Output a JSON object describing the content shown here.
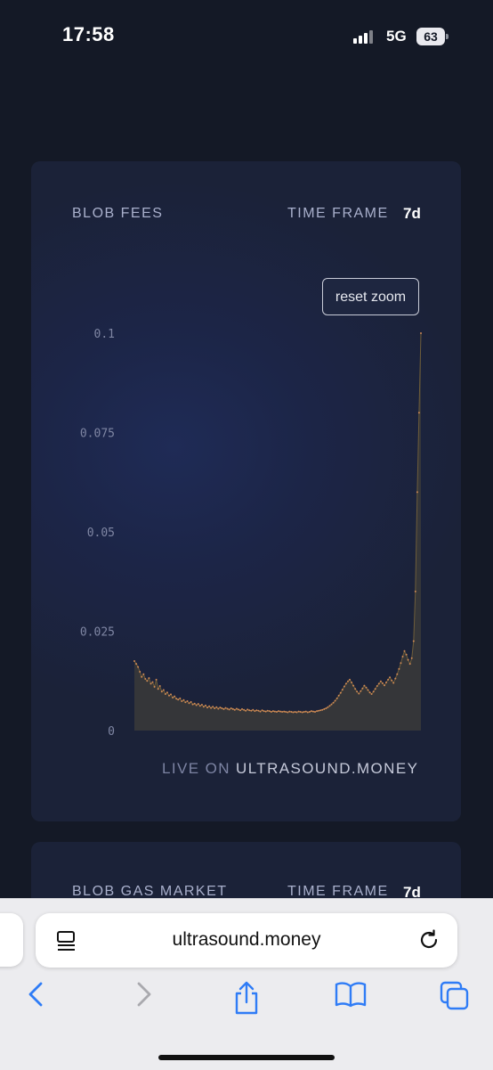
{
  "status_bar": {
    "time": "17:58",
    "network": "5G",
    "battery": "63"
  },
  "card": {
    "title": "BLOB FEES",
    "time_frame_label": "TIME FRAME",
    "time_frame_value": "7d",
    "reset_zoom_label": "reset zoom",
    "footer_prefix": "LIVE ON",
    "footer_site": "ULTRASOUND.MONEY"
  },
  "chart_data": {
    "type": "area",
    "title": "BLOB FEES",
    "xlabel": "",
    "ylabel": "",
    "ylim": [
      0,
      0.105
    ],
    "y_ticks": [
      0,
      0.025,
      0.05,
      0.075,
      0.1
    ],
    "y_tick_labels": [
      "0",
      "0.025",
      "0.05",
      "0.075",
      "0.1"
    ],
    "grid": false,
    "series": [
      {
        "values": [
          0.0175,
          0.0168,
          0.016,
          0.0148,
          0.0135,
          0.0142,
          0.013,
          0.0125,
          0.0132,
          0.0118,
          0.0122,
          0.011,
          0.0128,
          0.0105,
          0.0112,
          0.0098,
          0.0102,
          0.0092,
          0.0096,
          0.0088,
          0.0091,
          0.0083,
          0.0086,
          0.008,
          0.0078,
          0.0081,
          0.0074,
          0.0077,
          0.0071,
          0.0074,
          0.0069,
          0.0072,
          0.0066,
          0.0068,
          0.0064,
          0.0067,
          0.0062,
          0.0065,
          0.006,
          0.0063,
          0.0058,
          0.0061,
          0.0057,
          0.006,
          0.0056,
          0.0059,
          0.0055,
          0.0058,
          0.0056,
          0.0054,
          0.0057,
          0.0055,
          0.0053,
          0.0056,
          0.0054,
          0.0052,
          0.0055,
          0.0053,
          0.0051,
          0.0054,
          0.0052,
          0.005,
          0.0053,
          0.0051,
          0.005,
          0.0052,
          0.0049,
          0.0051,
          0.005,
          0.0048,
          0.0051,
          0.0049,
          0.0048,
          0.005,
          0.0049,
          0.0047,
          0.0049,
          0.0048,
          0.0047,
          0.0049,
          0.0048,
          0.0047,
          0.0048,
          0.0047,
          0.0046,
          0.0048,
          0.0047,
          0.0046,
          0.0047,
          0.0046,
          0.0048,
          0.0047,
          0.0046,
          0.0047,
          0.0048,
          0.0046,
          0.0047,
          0.0049,
          0.0048,
          0.0047,
          0.0049,
          0.005,
          0.0051,
          0.0052,
          0.0054,
          0.0056,
          0.0059,
          0.0062,
          0.0066,
          0.007,
          0.0075,
          0.0081,
          0.0088,
          0.0095,
          0.0103,
          0.0111,
          0.0118,
          0.0124,
          0.0128,
          0.0121,
          0.0113,
          0.0105,
          0.0098,
          0.0093,
          0.0099,
          0.0106,
          0.0113,
          0.0108,
          0.0102,
          0.0096,
          0.0092,
          0.0098,
          0.0105,
          0.0112,
          0.0118,
          0.0124,
          0.0119,
          0.0114,
          0.0121,
          0.0128,
          0.0134,
          0.0126,
          0.012,
          0.0131,
          0.0142,
          0.0155,
          0.017,
          0.0186,
          0.02,
          0.0191,
          0.0178,
          0.0168,
          0.0182,
          0.0225,
          0.035,
          0.06,
          0.08,
          0.1
        ]
      }
    ]
  },
  "card2": {
    "title": "BLOB GAS MARKET",
    "time_frame_label": "TIME FRAME",
    "time_frame_value": "7d"
  },
  "browser": {
    "url": "ultrasound.money"
  },
  "icons": {
    "reader": "reader-mode-icon",
    "reload": "reload-icon",
    "back": "back-icon",
    "forward": "forward-icon",
    "share": "share-icon",
    "bookmarks": "bookmarks-icon",
    "tabs": "tabs-icon"
  },
  "colors": {
    "page_bg": "#141926",
    "card_bg": "#1b2238",
    "area_fill": "#3a3a3a",
    "line": "#6e5d3a",
    "dots": "#d08a54",
    "accent_blue": "#2f7cf6"
  }
}
